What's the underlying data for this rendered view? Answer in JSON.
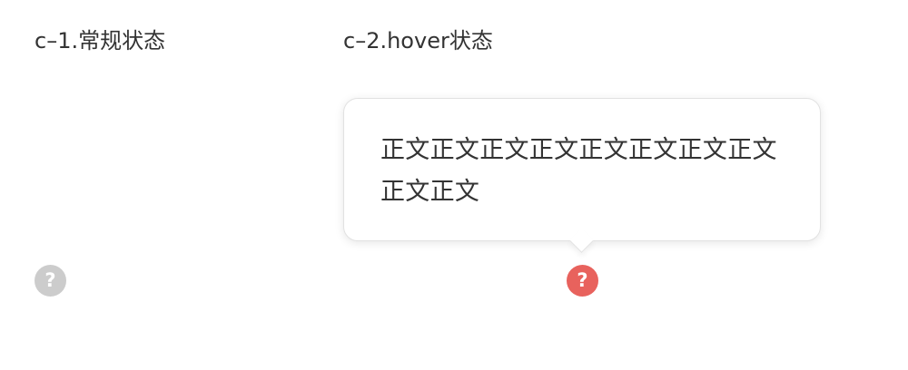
{
  "states": {
    "normal": {
      "label": "c–1.常规状态",
      "icon": "question-circle-icon",
      "icon_glyph": "?",
      "icon_color": "#cccccc"
    },
    "hover": {
      "label": "c–2.hover状态",
      "icon": "question-circle-icon",
      "icon_glyph": "?",
      "icon_color": "#e8625d",
      "tooltip_text": "正文正文正文正文正文正文正文正文正文正文"
    }
  }
}
